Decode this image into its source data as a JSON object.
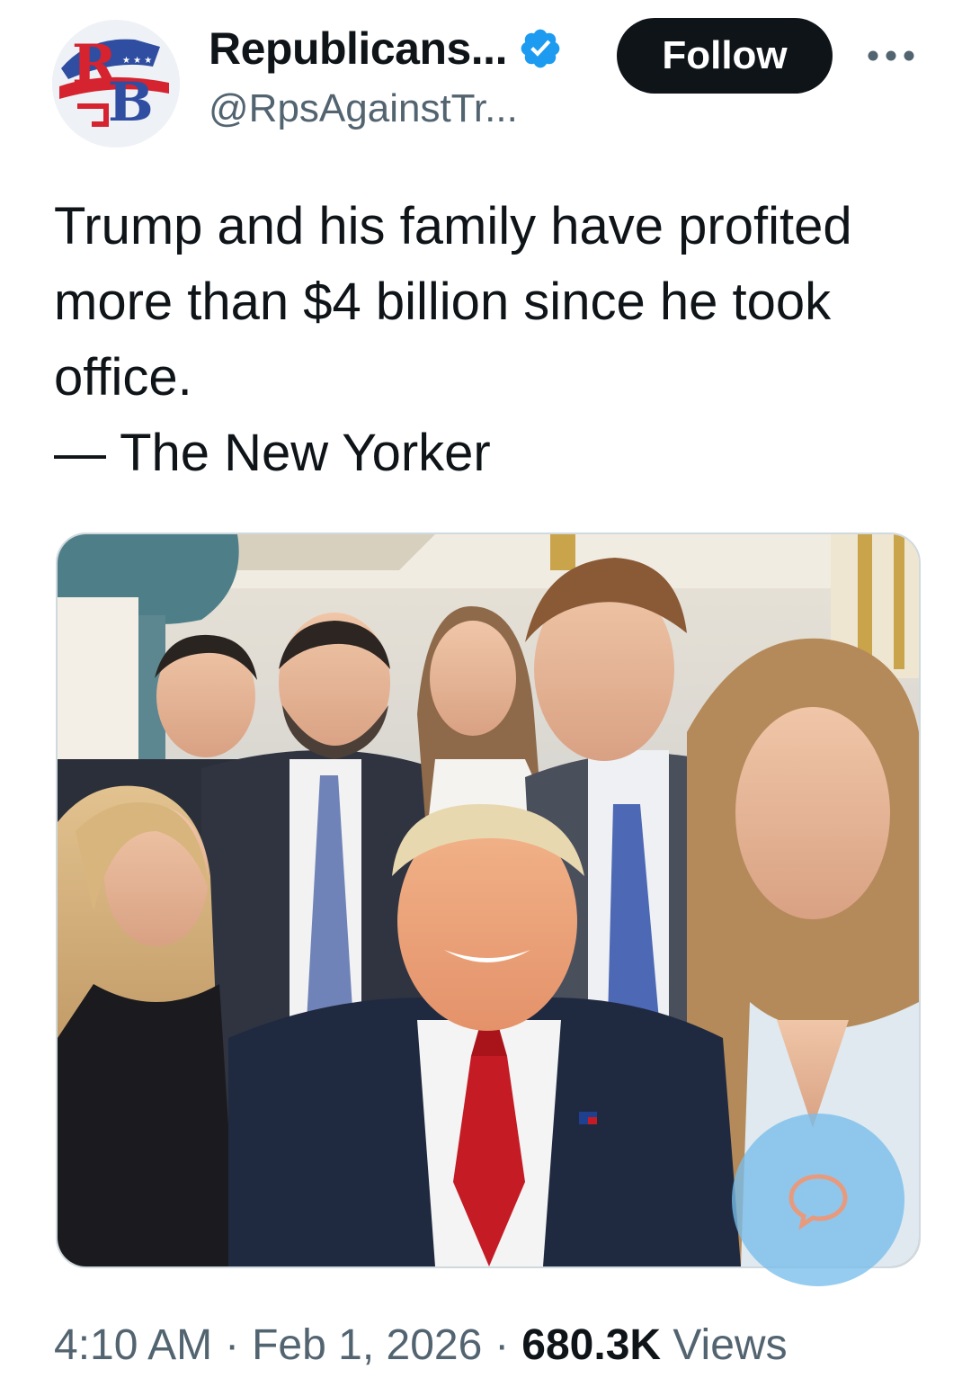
{
  "author": {
    "display_name": "Republicans...",
    "handle": "@RpsAgainstTr...",
    "avatar_monogram": "RB",
    "verified": true
  },
  "actions": {
    "follow_label": "Follow",
    "more_icon": "more-horizontal-icon"
  },
  "tweet": {
    "lines": [
      "Trump and his family have profited",
      "more than $4 billion since he took",
      "office.",
      "— The New Yorker"
    ]
  },
  "media": {
    "description": ""
  },
  "meta": {
    "time": "4:10 AM",
    "separator": "·",
    "date": "Feb 1, 2026",
    "views_count": "680.3K",
    "views_label": "Views"
  },
  "colors": {
    "verified_blue": "#1d9bf0",
    "follow_bg": "#0f1419",
    "muted_text": "#536471",
    "fab_blue": "#78beeb"
  },
  "icons": {
    "verified": "verified-badge-icon",
    "fab": "chat-bubble-icon"
  }
}
